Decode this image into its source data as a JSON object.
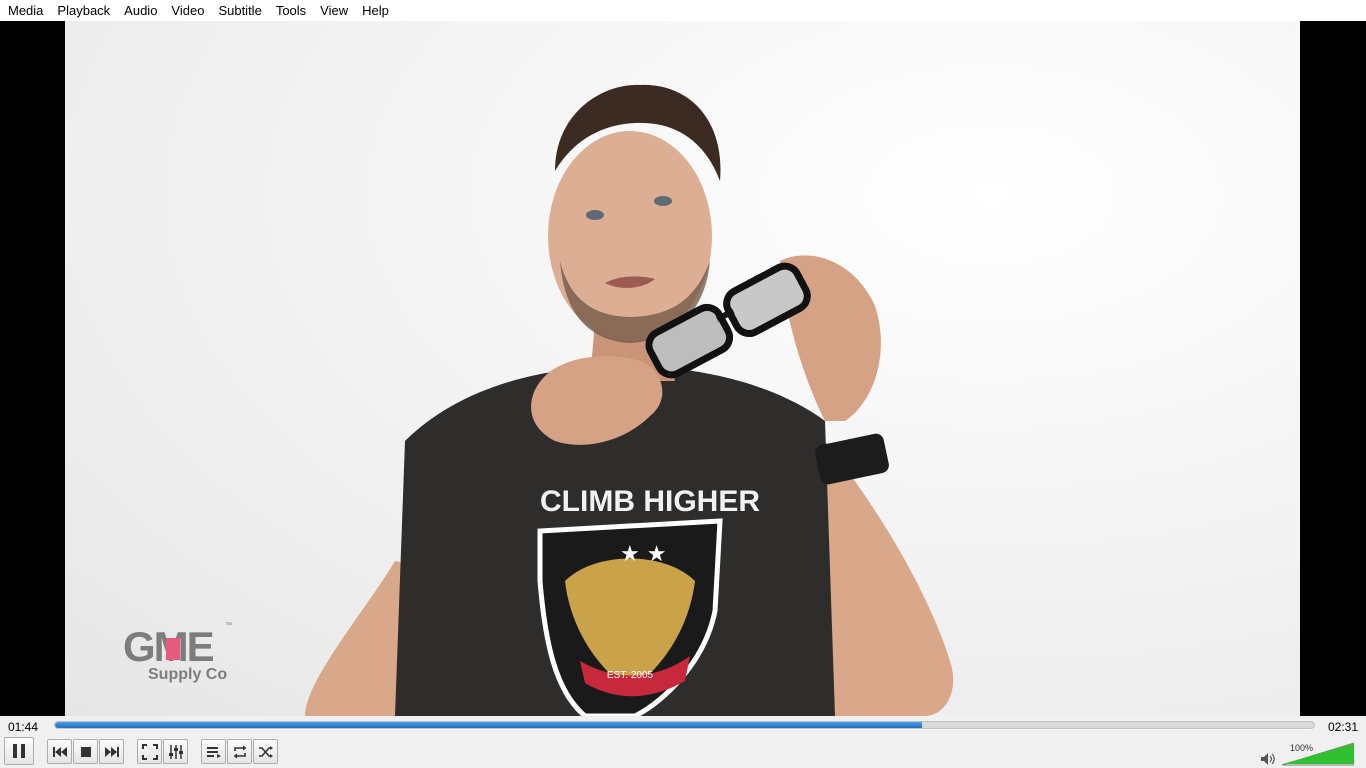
{
  "menu": {
    "items": [
      "Media",
      "Playback",
      "Audio",
      "Video",
      "Subtitle",
      "Tools",
      "View",
      "Help"
    ]
  },
  "video": {
    "logo_text_main": "GME",
    "logo_text_sub": "Supply Co",
    "shirt_text": "CLIMB HIGHER",
    "shirt_badge": "EST. 2005"
  },
  "playback": {
    "elapsed": "01:44",
    "total": "02:31",
    "progress": 0.689
  },
  "volume": {
    "label": "100%",
    "level": 1.0
  },
  "controls": {
    "icons": [
      "pause-icon",
      "previous-icon",
      "stop-icon",
      "next-icon",
      "fullscreen-icon",
      "extended-settings-icon",
      "playlist-icon",
      "loop-icon",
      "shuffle-icon",
      "speaker-icon"
    ]
  },
  "colors": {
    "seek_fill": "#1f6fc4",
    "volume_fill": "#2fbf2f"
  }
}
